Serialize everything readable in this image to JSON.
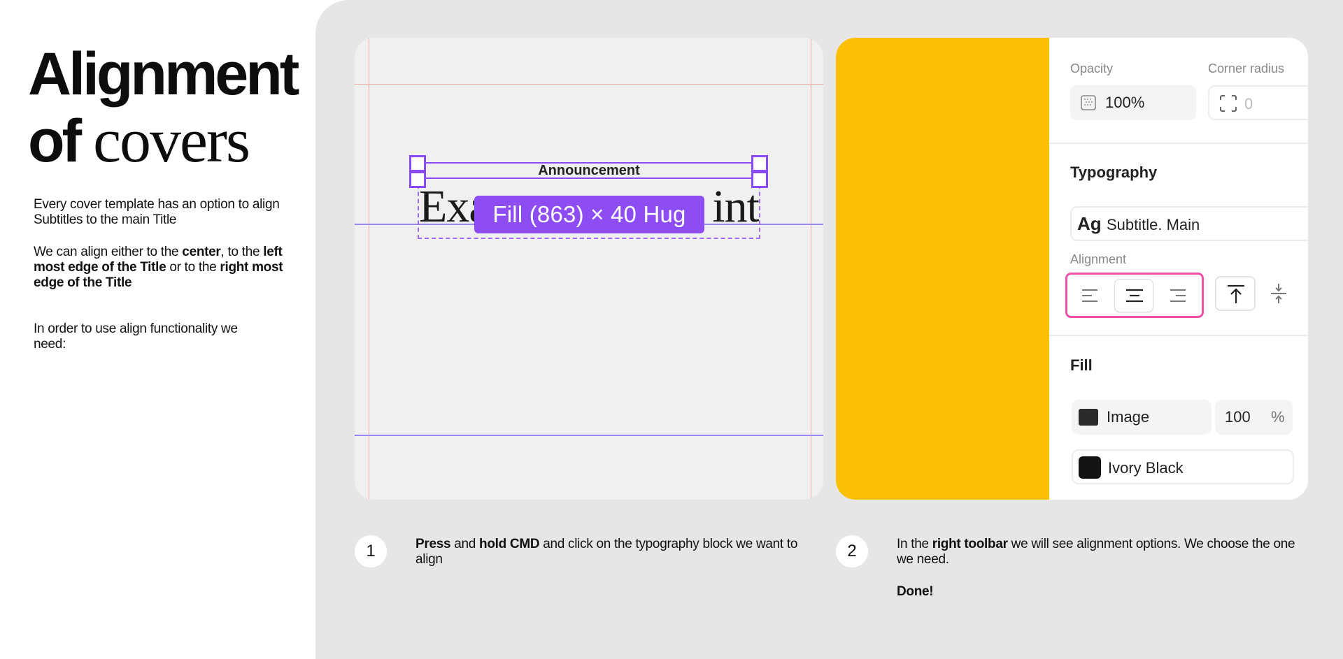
{
  "slide": {
    "title_line1": "Alignment",
    "title_line2_a": "of",
    "title_line2_b": "covers",
    "desc1": "Every cover template has an option to align Subtitles to the main Title",
    "desc2": {
      "t1": "We can align either to the ",
      "b1": "center",
      "t2": ", to the ",
      "b2": "left most edge of the Title",
      "t3": " or to the ",
      "b3": "right most edge of the Title"
    },
    "desc3": "In order to use align functionality we need:"
  },
  "canvas": {
    "subtitle_text": "Announcement",
    "title_left": "Exa",
    "title_right": "int",
    "size_badge": "Fill (863) × 40 Hug",
    "colors": {
      "selection": "#8a4cf2",
      "guide_red": "#f2a7a7",
      "guide_blue": "#9b86f5"
    }
  },
  "properties": {
    "opacity_label": "Opacity",
    "opacity_value": "100%",
    "corner_radius_label": "Corner radius",
    "corner_radius_value": "0",
    "typography_label": "Typography",
    "typography_icon_text": "Ag",
    "typography_style": "Subtitle. Main",
    "alignment_label": "Alignment",
    "fill_label": "Fill",
    "fill_type": "Image",
    "fill_opacity": "100",
    "fill_unit": "%",
    "fill_color_name": "Ivory Black",
    "colors": {
      "preview": "#fbbf04",
      "highlight": "#ee4fa8"
    }
  },
  "steps": [
    {
      "number": "1",
      "b1": "Press",
      "t1": " and ",
      "b2": "hold CMD",
      "t2": " and click on the typography block we want to align"
    },
    {
      "number": "2",
      "t1": "In the ",
      "b1": "right toolbar",
      "t2": " we will see alignment options. We choose the one we need.",
      "done": "Done!"
    }
  ]
}
